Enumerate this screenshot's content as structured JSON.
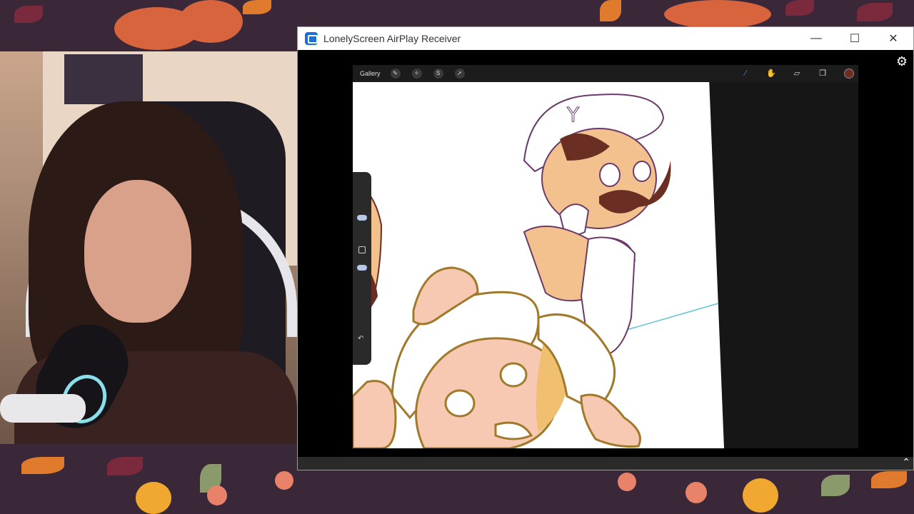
{
  "window": {
    "title": "LonelyScreen AirPlay Receiver",
    "minimize_glyph": "—",
    "maximize_glyph": "☐",
    "close_glyph": "✕",
    "settings_glyph": "⚙",
    "expand_glyph": "⌃"
  },
  "procreate": {
    "gallery_label": "Gallery",
    "left_tools": [
      {
        "icon": "wrench-icon",
        "glyph": "✎"
      },
      {
        "icon": "magic-wand-icon",
        "glyph": "✧"
      },
      {
        "icon": "selection-icon",
        "glyph": "S"
      },
      {
        "icon": "transform-icon",
        "glyph": "➚"
      }
    ],
    "right_tools": [
      {
        "icon": "brush-icon",
        "glyph": "⁄"
      },
      {
        "icon": "smudge-icon",
        "glyph": "✋"
      },
      {
        "icon": "eraser-icon",
        "glyph": "▱"
      },
      {
        "icon": "layers-icon",
        "glyph": "❐"
      }
    ],
    "active_color": "#6e2c22",
    "undo_glyph": "↶"
  },
  "colors": {
    "background": "#3a2838",
    "accent_blue": "#1e6fd9",
    "mic_ring": "#8ae0ea"
  }
}
